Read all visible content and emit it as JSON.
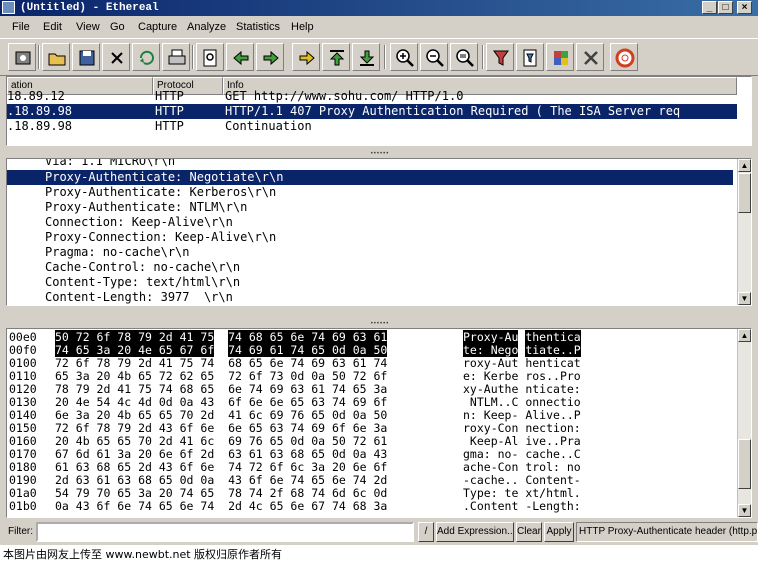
{
  "window": {
    "title": "(Untitled) - Ethereal"
  },
  "menu": [
    "File",
    "Edit",
    "View",
    "Go",
    "Capture",
    "Analyze",
    "Statistics",
    "Help"
  ],
  "toolbar": {
    "buttons": [
      "interfaces-icon",
      "open-icon",
      "save-icon",
      "close-icon",
      "reload-icon",
      "print-icon",
      "find-icon",
      "back-icon",
      "forward-icon",
      "goto-icon",
      "first-packet-icon",
      "last-packet-icon",
      "zoom-in-icon",
      "zoom-out-icon",
      "zoom-normal-icon",
      "capture-filter-icon",
      "display-filter-icon",
      "coloring-icon",
      "preferences-icon",
      "help-icon"
    ]
  },
  "packet_list": {
    "columns": [
      "ation",
      "Protocol",
      "Info"
    ],
    "rows": [
      {
        "dest": "18.89.12",
        "protocol": "HTTP",
        "info": "GET http://www.sohu.com/ HTTP/1.0"
      },
      {
        "dest": ".18.89.98",
        "protocol": "HTTP",
        "info": "HTTP/1.1 407 Proxy Authentication Required ( The ISA Server req"
      },
      {
        "dest": ".18.89.98",
        "protocol": "HTTP",
        "info": "Continuation"
      }
    ]
  },
  "details": {
    "lines": [
      "Via: 1.1 MICRO\\r\\n",
      "Proxy-Authenticate: Negotiate\\r\\n",
      "Proxy-Authenticate: Kerberos\\r\\n",
      "Proxy-Authenticate: NTLM\\r\\n",
      "Connection: Keep-Alive\\r\\n",
      "Proxy-Connection: Keep-Alive\\r\\n",
      "Pragma: no-cache\\r\\n",
      "Cache-Control: no-cache\\r\\n",
      "Content-Type: text/html\\r\\n",
      "Content-Length: 3977  \\r\\n"
    ]
  },
  "hex": {
    "rows": [
      {
        "off": "00e0",
        "h1": "50 72 6f 78 79 2d 41 75",
        "h2": "74 68 65 6e 74 69 63 61",
        "a1": "Proxy-Au",
        "a2": "thentica"
      },
      {
        "off": "00f0",
        "h1": "74 65 3a 20 4e 65 67 6f",
        "h2": "74 69 61 74 65 0d 0a 50",
        "a1": "te: Nego",
        "a2": "tiate..P"
      },
      {
        "off": "0100",
        "h1": "72 6f 78 79 2d 41 75 74",
        "h2": "68 65 6e 74 69 63 61 74",
        "a1": "roxy-Aut",
        "a2": "henticat"
      },
      {
        "off": "0110",
        "h1": "65 3a 20 4b 65 72 62 65",
        "h2": "72 6f 73 0d 0a 50 72 6f",
        "a1": "e: Kerbe",
        "a2": "ros..Pro"
      },
      {
        "off": "0120",
        "h1": "78 79 2d 41 75 74 68 65",
        "h2": "6e 74 69 63 61 74 65 3a",
        "a1": "xy-Authe",
        "a2": "nticate:"
      },
      {
        "off": "0130",
        "h1": "20 4e 54 4c 4d 0d 0a 43",
        "h2": "6f 6e 6e 65 63 74 69 6f",
        "a1": " NTLM..C",
        "a2": "onnectio"
      },
      {
        "off": "0140",
        "h1": "6e 3a 20 4b 65 65 70 2d",
        "h2": "41 6c 69 76 65 0d 0a 50",
        "a1": "n: Keep-",
        "a2": "Alive..P"
      },
      {
        "off": "0150",
        "h1": "72 6f 78 79 2d 43 6f 6e",
        "h2": "6e 65 63 74 69 6f 6e 3a",
        "a1": "roxy-Con",
        "a2": "nection:"
      },
      {
        "off": "0160",
        "h1": "20 4b 65 65 70 2d 41 6c",
        "h2": "69 76 65 0d 0a 50 72 61",
        "a1": " Keep-Al",
        "a2": "ive..Pra"
      },
      {
        "off": "0170",
        "h1": "67 6d 61 3a 20 6e 6f 2d",
        "h2": "63 61 63 68 65 0d 0a 43",
        "a1": "gma: no-",
        "a2": "cache..C"
      },
      {
        "off": "0180",
        "h1": "61 63 68 65 2d 43 6f 6e",
        "h2": "74 72 6f 6c 3a 20 6e 6f",
        "a1": "ache-Con",
        "a2": "trol: no"
      },
      {
        "off": "0190",
        "h1": "2d 63 61 63 68 65 0d 0a",
        "h2": "43 6f 6e 74 65 6e 74 2d",
        "a1": "-cache..",
        "a2": "Content-"
      },
      {
        "off": "01a0",
        "h1": "54 79 70 65 3a 20 74 65",
        "h2": "78 74 2f 68 74 6d 6c 0d",
        "a1": "Type: te",
        "a2": "xt/html."
      },
      {
        "off": "01b0",
        "h1": "0a 43 6f 6e 74 65 6e 74",
        "h2": "2d 4c 65 6e 67 74 68 3a",
        "a1": ".Content",
        "a2": "-Length:"
      }
    ]
  },
  "filterbar": {
    "label": "Filter:",
    "value": "",
    "add_expression": "Add Expression...",
    "clear": "Clear",
    "apply": "Apply",
    "status": "HTTP Proxy-Authenticate header (http.pro"
  },
  "caption": "本图片由网友上传至 www.newbt.net 版权归原作者所有"
}
